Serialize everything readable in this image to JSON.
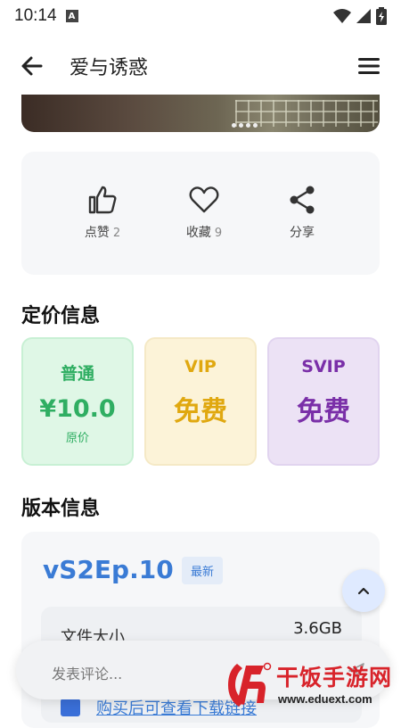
{
  "status_bar": {
    "time": "10:14",
    "notification_glyph": "A"
  },
  "app_bar": {
    "title": "爱与诱惑",
    "back_icon": "arrow-left-icon",
    "menu_icon": "hamburger-menu-icon"
  },
  "actions": [
    {
      "label": "点赞",
      "count": "2",
      "icon": "thumbs-up-icon"
    },
    {
      "label": "收藏",
      "count": "9",
      "icon": "heart-icon"
    },
    {
      "label": "分享",
      "count": "",
      "icon": "share-icon"
    }
  ],
  "pricing": {
    "title": "定价信息",
    "cards": [
      {
        "tier": "普通",
        "price": "¥10.0",
        "note": "原价",
        "color": "#2fae62"
      },
      {
        "tier": "VIP",
        "price": "免费",
        "color": "#e0a810"
      },
      {
        "tier": "SVIP",
        "price": "免费",
        "color": "#7a2fa8"
      }
    ]
  },
  "version": {
    "title": "版本信息",
    "name": "vS2Ep.10",
    "badge": "最新",
    "file_size_label": "文件大小",
    "file_size_value": "3.6GB"
  },
  "comment": {
    "placeholder": "发表评论..."
  },
  "buy_hint": "购买后可查看下载链接",
  "watermark": {
    "name": "干饭手游网",
    "url": "www.eduext.com"
  },
  "colors": {
    "accent": "#3a7bd5",
    "brand_red": "#d8232a"
  }
}
